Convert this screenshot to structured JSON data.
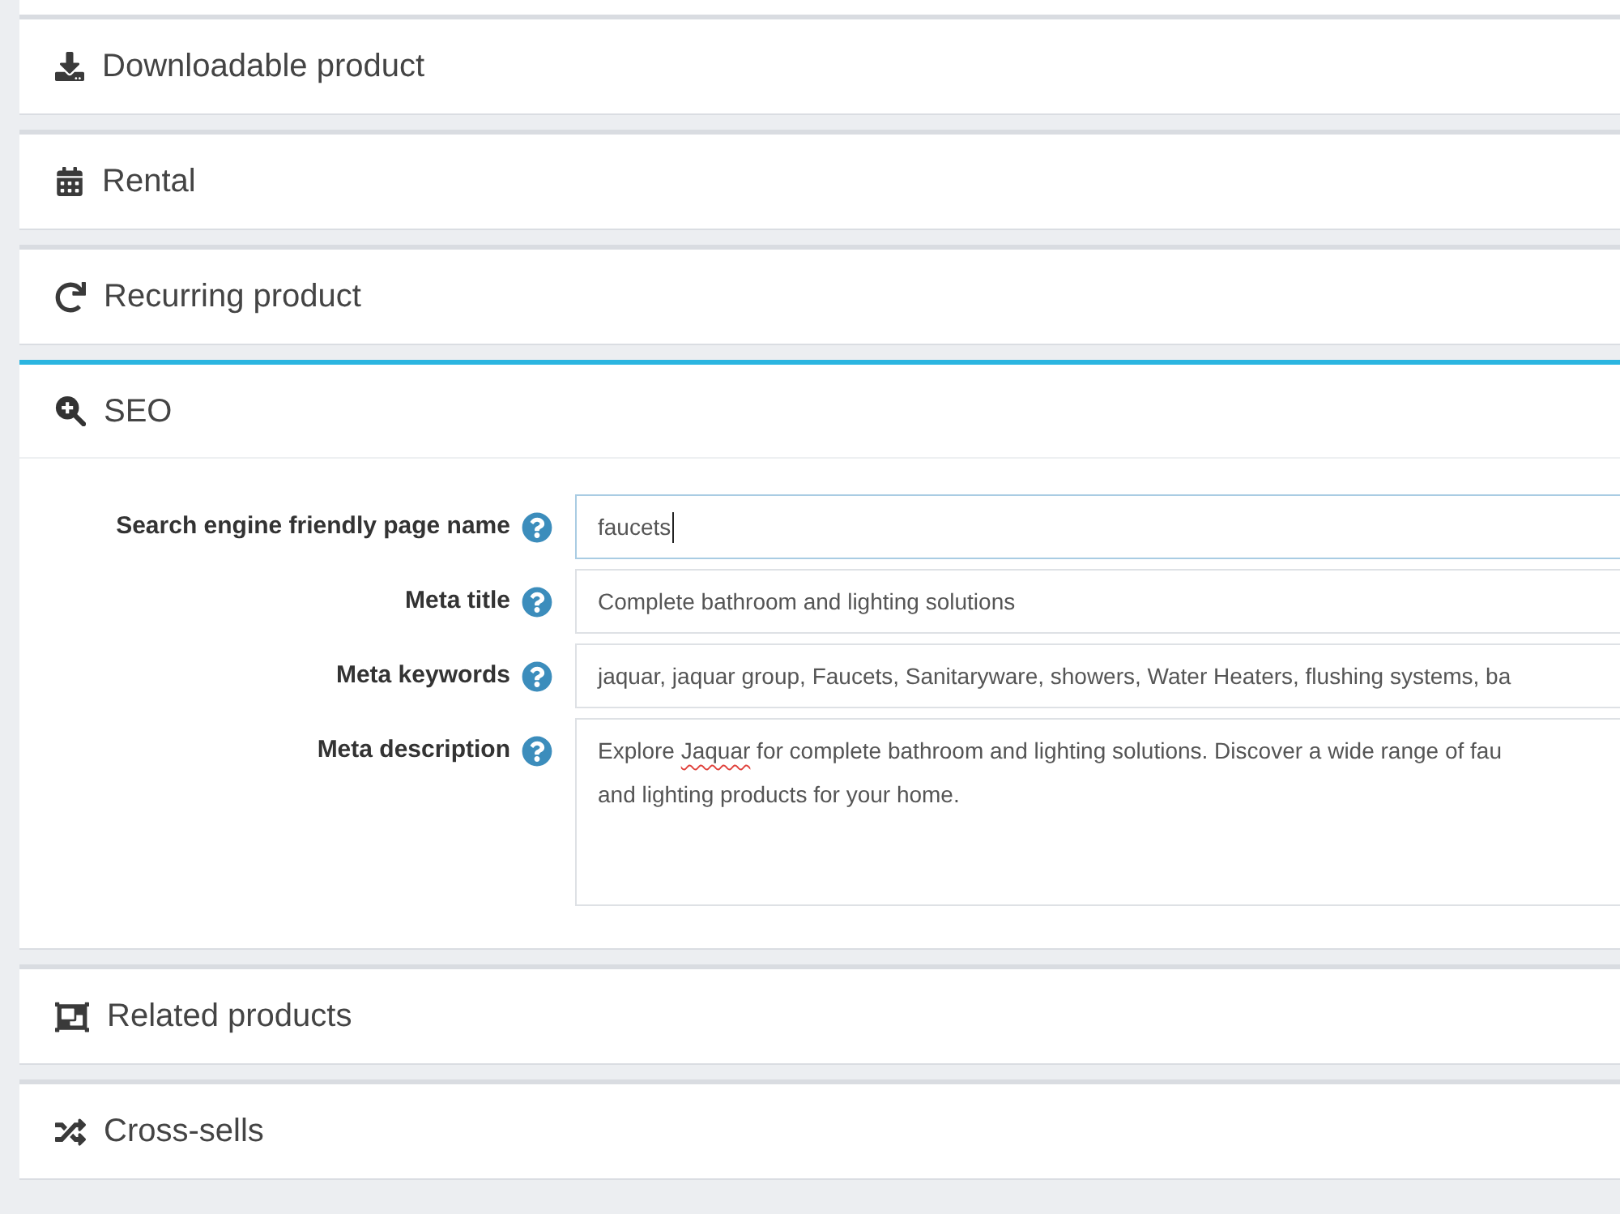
{
  "panels": [
    {
      "title": "Downloadable product",
      "expanded": false
    },
    {
      "title": "Rental",
      "expanded": false
    },
    {
      "title": "Recurring product",
      "expanded": false
    },
    {
      "title": "SEO",
      "expanded": true,
      "fields": [
        {
          "label": "Search engine friendly page name",
          "kind": "input",
          "value": "faucets",
          "focused": true
        },
        {
          "label": "Meta title",
          "kind": "input",
          "value": "Complete bathroom and lighting solutions",
          "focused": false
        },
        {
          "label": "Meta keywords",
          "kind": "input",
          "value": "jaquar, jaquar group, Faucets, Sanitaryware, showers, Water Heaters, flushing systems, ba",
          "focused": false
        },
        {
          "label": "Meta description",
          "kind": "textarea",
          "focused": false,
          "lines": [
            [
              {
                "text": "Explore ",
                "misspelled": false
              },
              {
                "text": "Jaquar",
                "misspelled": true
              },
              {
                "text": " for complete bathroom and lighting solutions. Discover a wide range of fau",
                "misspelled": false
              }
            ],
            [
              {
                "text": "and lighting products for your home.",
                "misspelled": false
              }
            ]
          ]
        }
      ]
    },
    {
      "title": "Related products",
      "expanded": false
    },
    {
      "title": "Cross-sells",
      "expanded": false
    }
  ]
}
